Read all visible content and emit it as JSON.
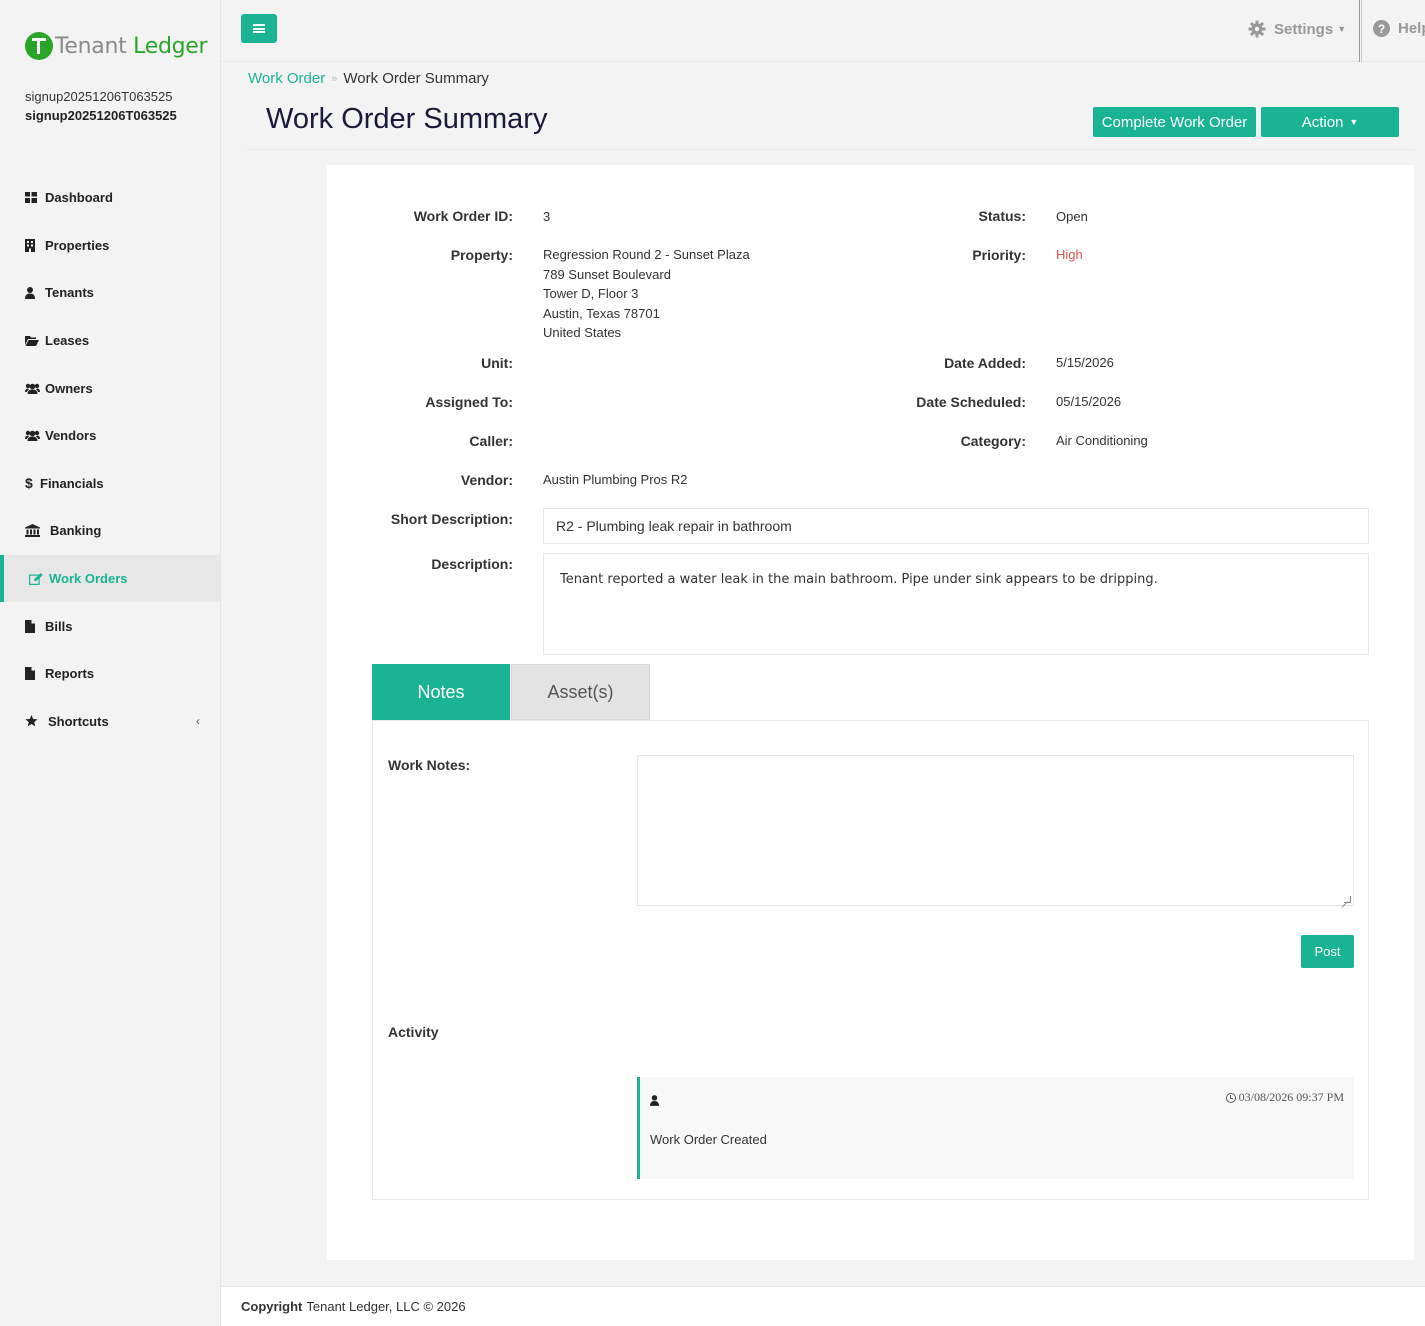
{
  "brand": {
    "name_part1": "Tenant",
    "name_part2": "Ledger",
    "color_accent": "#1ab394",
    "logo_color": "#2aa52a"
  },
  "user": {
    "line1": "signup20251206T063525",
    "line2": "signup20251206T063525"
  },
  "sidebar": {
    "items": [
      {
        "label": "Dashboard",
        "icon": "dashboard-icon"
      },
      {
        "label": "Properties",
        "icon": "building-icon"
      },
      {
        "label": "Tenants",
        "icon": "user-icon"
      },
      {
        "label": "Leases",
        "icon": "folder-open-icon"
      },
      {
        "label": "Owners",
        "icon": "users-icon"
      },
      {
        "label": "Vendors",
        "icon": "users-icon"
      },
      {
        "label": "Financials",
        "icon": "dollar-icon"
      },
      {
        "label": "Banking",
        "icon": "bank-icon"
      },
      {
        "label": "Work Orders",
        "icon": "edit-icon",
        "active": true
      },
      {
        "label": "Bills",
        "icon": "file-icon"
      },
      {
        "label": "Reports",
        "icon": "file-icon"
      },
      {
        "label": "Shortcuts",
        "icon": "star-icon"
      }
    ],
    "shortcuts_chevron": "‹"
  },
  "topbar": {
    "settings_label": "Settings",
    "help_label": "Help"
  },
  "breadcrumb": {
    "parent": "Work Order",
    "current": "Work Order Summary"
  },
  "page": {
    "title": "Work Order Summary",
    "complete_button": "Complete Work Order",
    "action_button": "Action"
  },
  "work_order": {
    "labels": {
      "id": "Work Order ID:",
      "status": "Status:",
      "property": "Property:",
      "priority": "Priority:",
      "unit": "Unit:",
      "date_added": "Date Added:",
      "assigned_to": "Assigned To:",
      "date_scheduled": "Date Scheduled:",
      "caller": "Caller:",
      "category": "Category:",
      "vendor": "Vendor:",
      "short_description": "Short Description:",
      "description": "Description:"
    },
    "id": "3",
    "status": "Open",
    "property": {
      "name": "Regression Round 2 - Sunset Plaza",
      "street": "789 Sunset Boulevard",
      "line2": "Tower D, Floor 3",
      "city": "Austin, Texas 78701",
      "country": "United States"
    },
    "priority": "High",
    "priority_color": "#d9534f",
    "unit": "",
    "date_added": "5/15/2026",
    "assigned_to": "",
    "date_scheduled": "05/15/2026",
    "caller": "",
    "category": "Air Conditioning",
    "vendor": "Austin Plumbing Pros R2",
    "short_description": "R2 - Plumbing leak repair in bathroom",
    "description": "Tenant reported a water leak in the main bathroom. Pipe under sink appears to be dripping."
  },
  "tabs": {
    "notes": "Notes",
    "assets": "Asset(s)"
  },
  "notes": {
    "work_notes_label": "Work Notes:",
    "work_notes_value": "",
    "post_button": "Post",
    "activity_label": "Activity",
    "activity": [
      {
        "timestamp": "03/08/2026 09:37 PM",
        "text": "Work Order Created"
      }
    ]
  },
  "footer": {
    "bold": "Copyright",
    "text": "Tenant Ledger, LLC © 2026"
  }
}
